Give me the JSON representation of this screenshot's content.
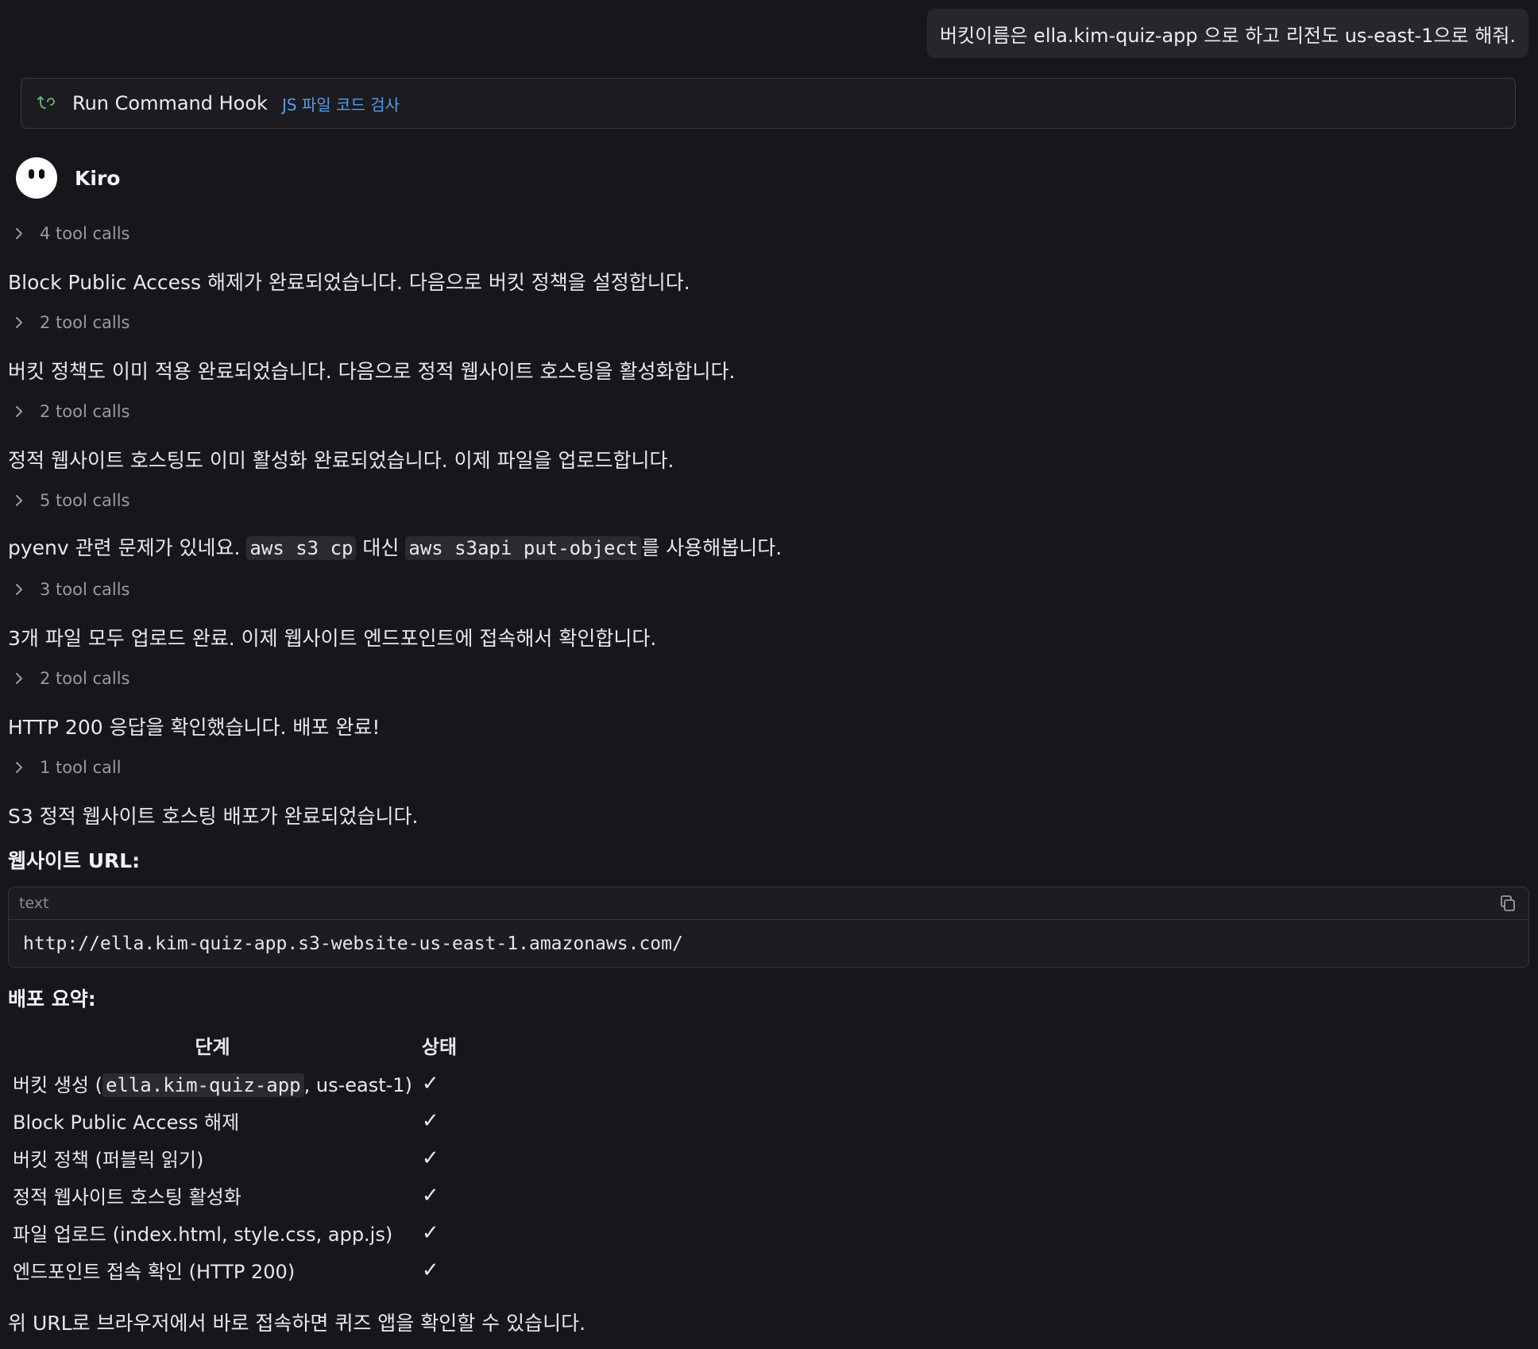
{
  "user_message": "버킷이름은 ella.kim-quiz-app 으로 하고 리전도 us-east-1으로 해줘.",
  "hook": {
    "title": "Run Command Hook",
    "tag": "JS 파일 코드 검사",
    "icon": "hook-arrow-icon"
  },
  "agent": {
    "name": "Kiro"
  },
  "transcript": {
    "tool1": "4 tool calls",
    "msg1": "Block Public Access 해제가 완료되었습니다. 다음으로 버킷 정책을 설정합니다.",
    "tool2": "2 tool calls",
    "msg2": "버킷 정책도 이미 적용 완료되었습니다. 다음으로 정적 웹사이트 호스팅을 활성화합니다.",
    "tool3": "2 tool calls",
    "msg3": "정적 웹사이트 호스팅도 이미 활성화 완료되었습니다. 이제 파일을 업로드합니다.",
    "tool4": "5 tool calls",
    "msg4_pre": "pyenv 관련 문제가 있네요. ",
    "msg4_code1": "aws s3 cp",
    "msg4_mid": " 대신 ",
    "msg4_code2": "aws s3api put-object",
    "msg4_post": "를 사용해봅니다.",
    "tool5": "3 tool calls",
    "msg5": "3개 파일 모두 업로드 완료. 이제 웹사이트 엔드포인트에 접속해서 확인합니다.",
    "tool6": "2 tool calls",
    "msg6": "HTTP 200 응답을 확인했습니다. 배포 완료!",
    "tool7": "1 tool call",
    "msg7": "S3 정적 웹사이트 호스팅 배포가 완료되었습니다."
  },
  "website_heading": "웹사이트 URL:",
  "code_block": {
    "lang": "text",
    "content": "http://ella.kim-quiz-app.s3-website-us-east-1.amazonaws.com/"
  },
  "summary": {
    "heading": "배포 요약:",
    "columns": [
      "단계",
      "상태"
    ],
    "rows": [
      {
        "pre": "버킷 생성 (",
        "code": "ella.kim-quiz-app",
        "post": ", us-east-1)",
        "status": "✓"
      },
      {
        "label": "Block Public Access 해제",
        "status": "✓"
      },
      {
        "label": "버킷 정책 (퍼블릭 읽기)",
        "status": "✓"
      },
      {
        "label": "정적 웹사이트 호스팅 활성화",
        "status": "✓"
      },
      {
        "label": "파일 업로드 (index.html, style.css, app.js)",
        "status": "✓"
      },
      {
        "label": "엔드포인트 접속 확인 (HTTP 200)",
        "status": "✓"
      }
    ]
  },
  "footer_msg": "위 URL로 브라우저에서 바로 접속하면 퀴즈 앱을 확인할 수 있습니다.",
  "colors": {
    "background": "#16161b",
    "accent_link": "#5c9be6",
    "hook_icon": "#6aa86f"
  }
}
